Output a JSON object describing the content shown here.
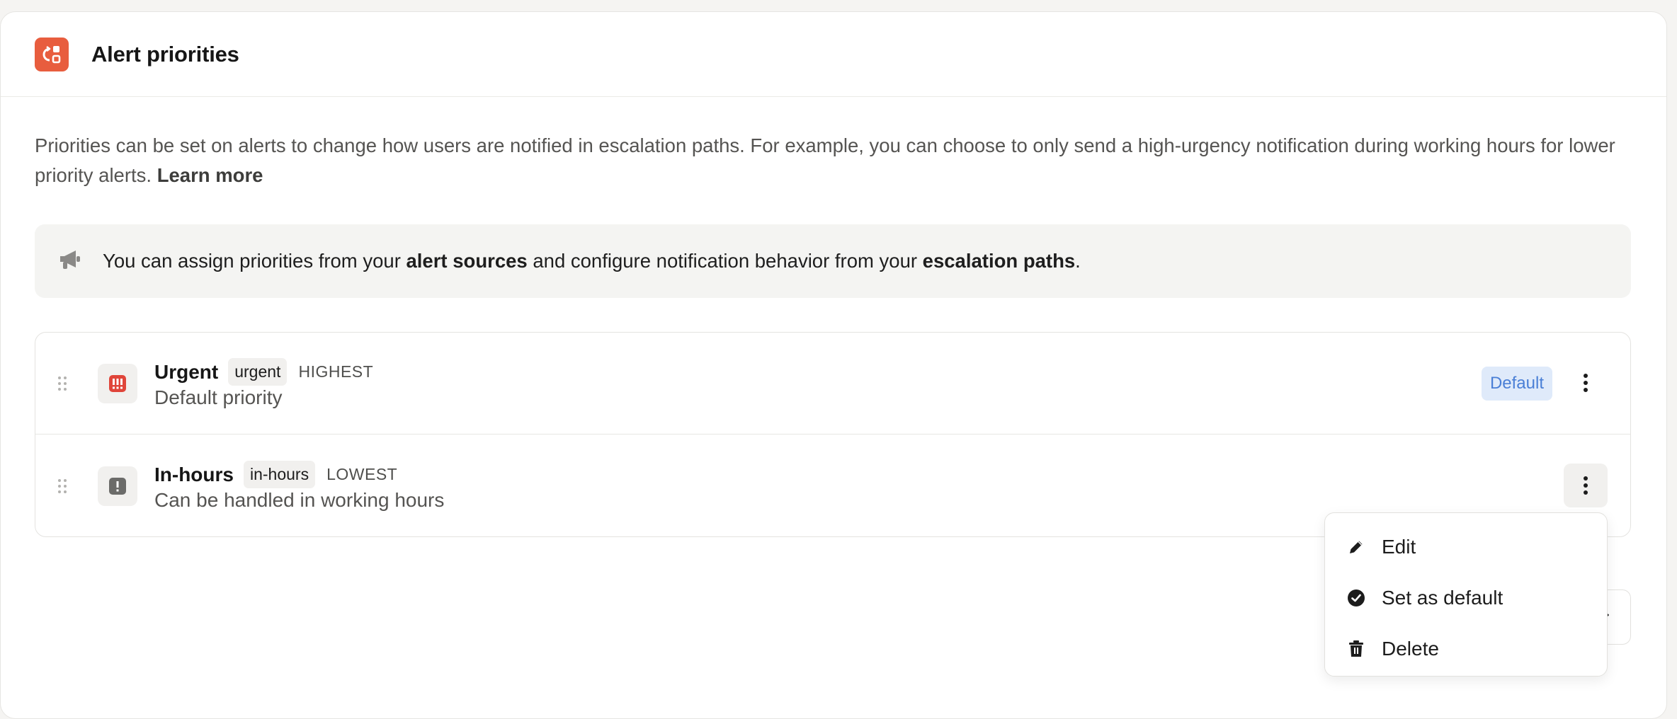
{
  "header": {
    "title": "Alert priorities",
    "icon": "escalation-icon",
    "accent": "#e85d3e"
  },
  "description": {
    "text": "Priorities can be set on alerts to change how users are notified in escalation paths. For example, you can choose to only send a high-urgency notification during working hours for lower priority alerts. ",
    "link": "Learn more"
  },
  "callout": {
    "icon": "megaphone-icon",
    "prefix": "You can assign priorities from your ",
    "bold1": "alert sources",
    "middle": " and configure notification behavior from your ",
    "bold2": "escalation paths",
    "suffix": "."
  },
  "priorities": [
    {
      "name": "Urgent",
      "slug": "urgent",
      "rank": "HIGHEST",
      "description": "Default priority",
      "badge": "Default",
      "icon": "urgent-alert-icon",
      "icon_color": "#e0453a"
    },
    {
      "name": "In-hours",
      "slug": "in-hours",
      "rank": "LOWEST",
      "description": "Can be handled in working hours",
      "icon": "alert-icon",
      "icon_color": "#6b6b69"
    }
  ],
  "menu": {
    "items": [
      {
        "label": "Edit",
        "icon": "pencil-icon"
      },
      {
        "label": "Set as default",
        "icon": "check-circle-icon"
      },
      {
        "label": "Delete",
        "icon": "trash-icon"
      }
    ]
  },
  "colors": {
    "badge_bg": "#dfeafa",
    "badge_text": "#4a7fd6"
  }
}
